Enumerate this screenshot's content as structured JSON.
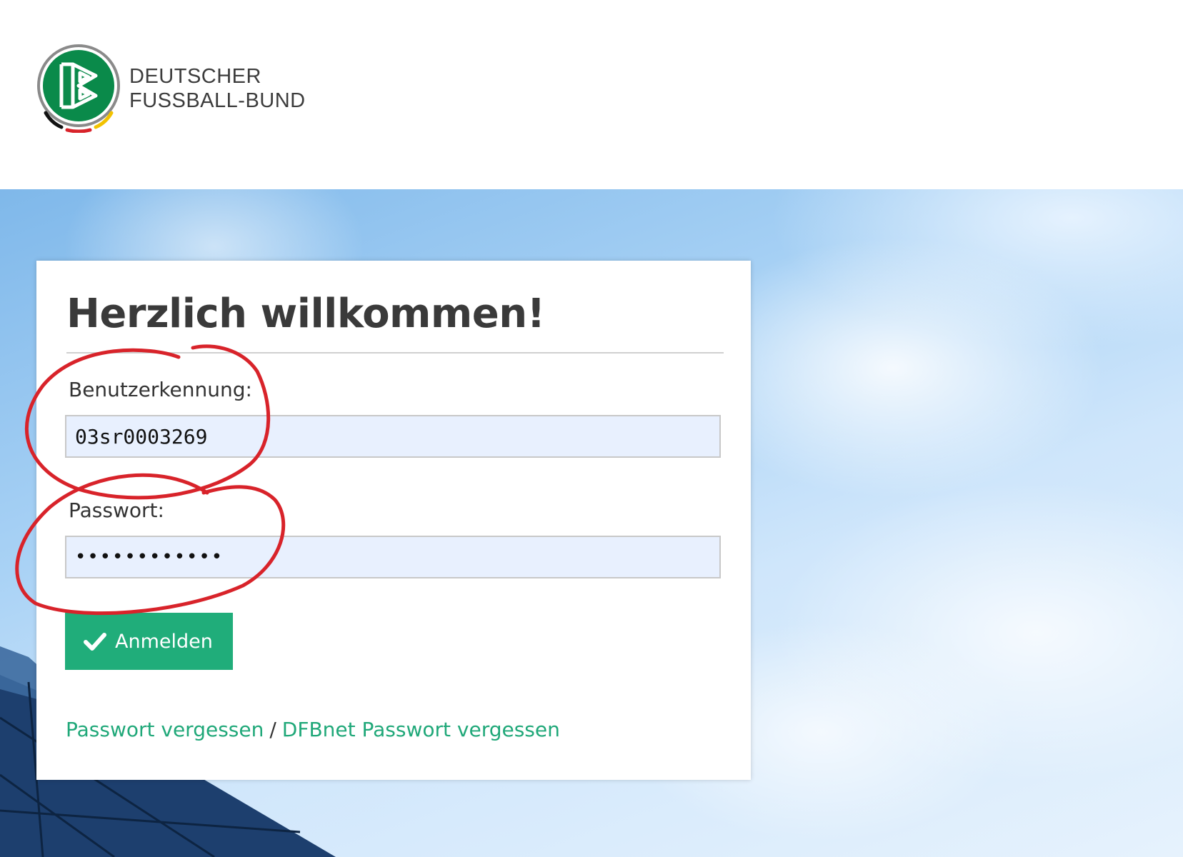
{
  "brand": {
    "line1": "DEUTSCHER",
    "line2": "FUSSBALL-BUND",
    "emblem_icon": "dfb-emblem-icon",
    "green": "#0a8a4a",
    "accent": "#20ad7a"
  },
  "login": {
    "title": "Herzlich willkommen!",
    "username_label": "Benutzerkennung:",
    "username_value": "03sr0003269",
    "password_label": "Passwort:",
    "password_value": "••••••••••••",
    "submit_label": "Anmelden",
    "submit_icon": "check-icon",
    "forgot_password_label": "Passwort vergessen",
    "separator": "/",
    "forgot_dfbnet_label": "DFBnet Passwort vergessen"
  },
  "annotation": {
    "color": "#d8232a",
    "marks": [
      "username-circle",
      "password-circle"
    ]
  }
}
